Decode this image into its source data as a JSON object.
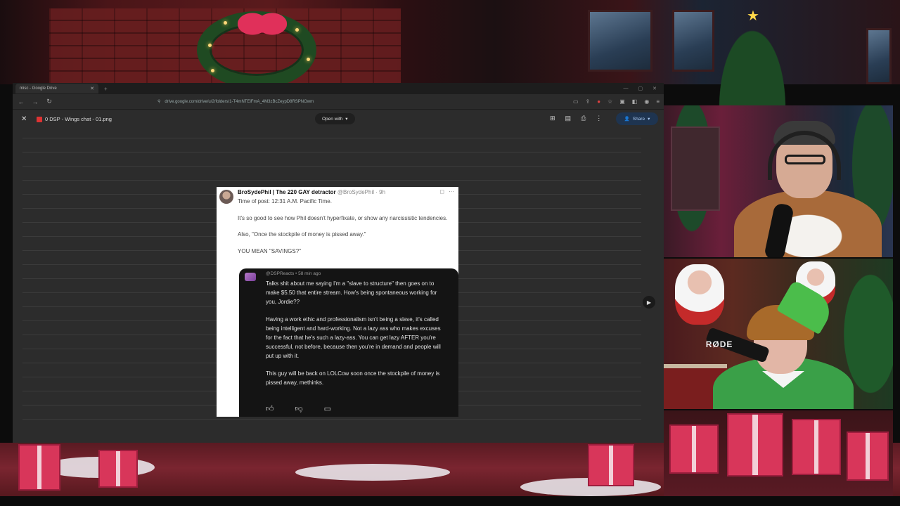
{
  "browser": {
    "tab_title": "misc - Google Drive",
    "url": "drive.google.com/drive/u/2/folders/1-T4mNTEiFmA_4M3zBcZeypD8RSPNOwm"
  },
  "viewer": {
    "file_name": "0 DSP - Wings chat - 01.png",
    "open_with_label": "Open with",
    "share_label": "Share",
    "zoom_minus": "−",
    "zoom_plus": "+"
  },
  "tweet": {
    "author_name": "BroSydePhil | The 220 GAY detractor",
    "author_handle": "@BroSydePhil · 9h",
    "lines": [
      "Time of post: 12:31 A.M. Pacific Time.",
      "It's so good to see how Phil doesn't hyperfixate, or show any narcissistic tendencies.",
      "Also, \"Once the stockpile of money is pissed away.\"",
      "YOU MEAN \"SAVINGS?\""
    ],
    "reply": {
      "handle": "@DSPReacts • 58 min ago",
      "paragraphs": [
        "Talks shit about me saying I'm a \"slave to structure\" then goes on to make $5.50 that entire stream. How's being spontaneous working for you, Jordie??",
        "Having a work ethic and professionalism isn't being a slave, it's called being intelligent and hard-working. Not a lazy ass who makes excuses for the fact that he's such a lazy-ass. You can get lazy AFTER you're successful, not before, because then you're in demand and people will put up with it.",
        "This guy will be back on LOLCow soon once the stockpile of money is pissed away, methinks."
      ]
    }
  },
  "webcam": {
    "mic_brand": "RØDE"
  },
  "colors": {
    "share_bg": "#1e3450",
    "reply_bg": "#141414"
  }
}
